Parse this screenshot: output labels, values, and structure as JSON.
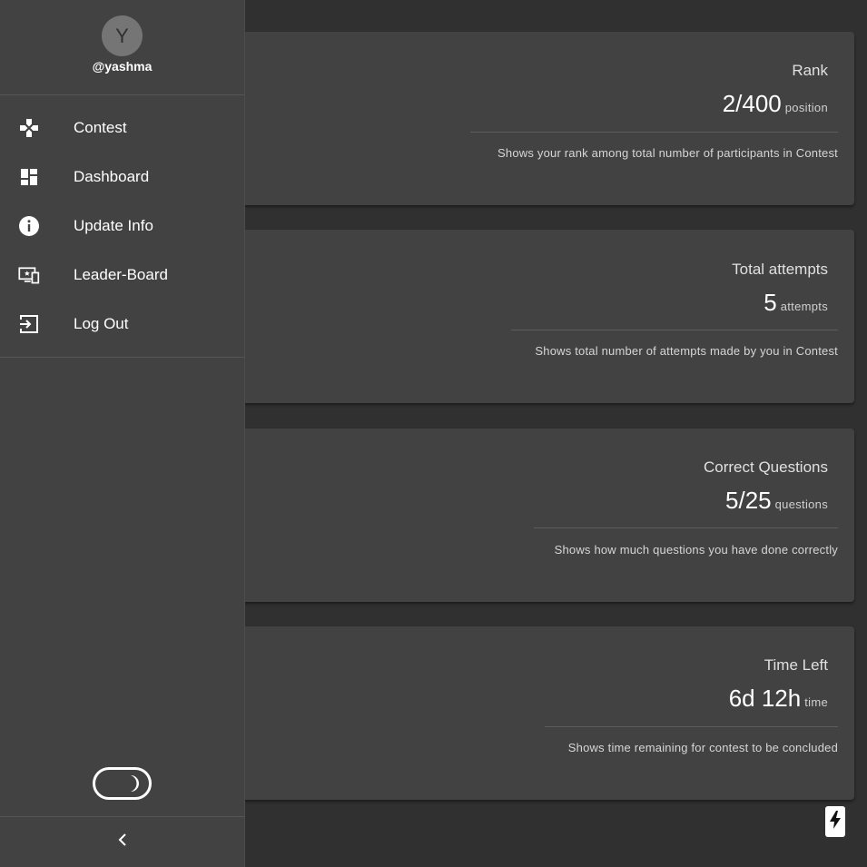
{
  "profile": {
    "avatar_initial": "Y",
    "username": "@yashma"
  },
  "nav": {
    "items": [
      {
        "label": "Contest",
        "icon": "gamepad-icon"
      },
      {
        "label": "Dashboard",
        "icon": "dashboard-icon"
      },
      {
        "label": "Update Info",
        "icon": "info-icon"
      },
      {
        "label": "Leader-Board",
        "icon": "devices-star-icon"
      },
      {
        "label": "Log Out",
        "icon": "logout-icon"
      }
    ]
  },
  "controls": {
    "theme_toggle_icon": "moon-icon",
    "collapse_icon": "chevron-left-icon",
    "fab_icon": "lightning-bolt-icon"
  },
  "cards": [
    {
      "title": "Rank",
      "value": "2/400",
      "unit": "position",
      "desc": "Shows your rank among total number of participants in Contest"
    },
    {
      "title": "Total attempts",
      "value": "5",
      "unit": "attempts",
      "desc": "Shows total number of attempts made by you in Contest"
    },
    {
      "title": "Correct Questions",
      "value": "5/25",
      "unit": "questions",
      "desc": "Shows how much questions you have done correctly"
    },
    {
      "title": "Time Left",
      "value": "6d 12h",
      "unit": "time",
      "desc": "Shows time remaining for contest to be concluded"
    }
  ],
  "colors": {
    "background": "#303030",
    "surface": "#424242",
    "avatar": "#757575",
    "text": "#ffffff"
  }
}
